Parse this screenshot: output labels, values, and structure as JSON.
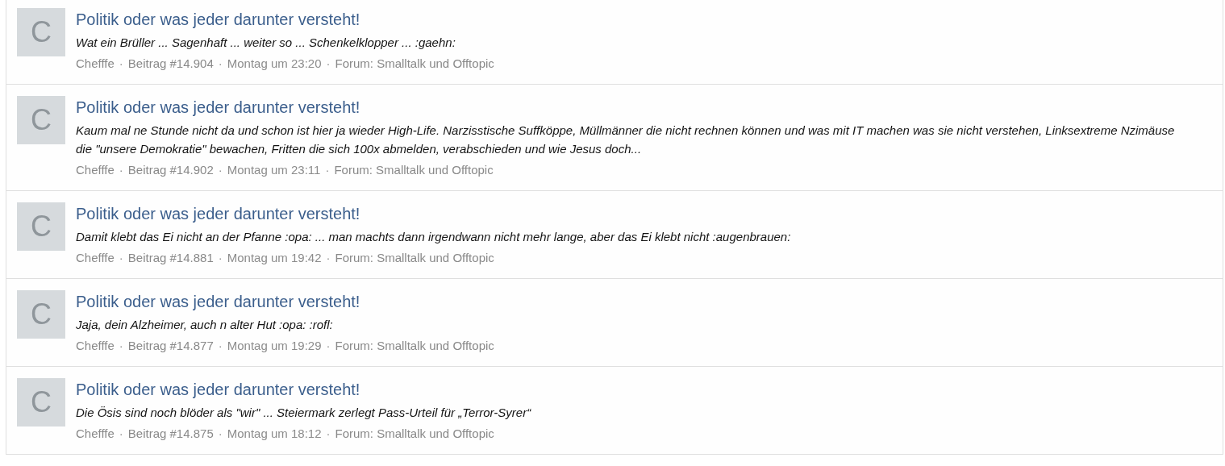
{
  "posts": [
    {
      "avatar_letter": "C",
      "title": "Politik oder was jeder darunter versteht!",
      "snippet": "Wat ein Brüller ... Sagenhaft ... weiter so ... Schenkelklopper ... :gaehn:",
      "meta": [
        {
          "kind": "author",
          "text": "Chefffe"
        },
        {
          "kind": "separator",
          "text": "·"
        },
        {
          "kind": "post_number",
          "text": "Beitrag #14.904"
        },
        {
          "kind": "separator",
          "text": "·"
        },
        {
          "kind": "time",
          "text": "Montag um 23:20"
        },
        {
          "kind": "separator",
          "text": "·"
        },
        {
          "kind": "forum",
          "text": "Forum: Smalltalk und Offtopic"
        }
      ]
    },
    {
      "avatar_letter": "C",
      "title": "Politik oder was jeder darunter versteht!",
      "snippet": "Kaum mal ne Stunde nicht da und schon ist hier ja wieder High-Life. Narzisstische Suffköppe, Müllmänner die nicht rechnen können und was mit IT machen was sie nicht verstehen, Linksextreme Nzimäuse die \"unsere Demokratie\" bewachen, Fritten die sich 100x abmelden, verabschieden und wie Jesus doch...",
      "meta": [
        {
          "kind": "author",
          "text": "Chefffe"
        },
        {
          "kind": "separator",
          "text": "·"
        },
        {
          "kind": "post_number",
          "text": "Beitrag #14.902"
        },
        {
          "kind": "separator",
          "text": "·"
        },
        {
          "kind": "time",
          "text": "Montag um 23:11"
        },
        {
          "kind": "separator",
          "text": "·"
        },
        {
          "kind": "forum",
          "text": "Forum: Smalltalk und Offtopic"
        }
      ]
    },
    {
      "avatar_letter": "C",
      "title": "Politik oder was jeder darunter versteht!",
      "snippet": "Damit klebt das Ei nicht an der Pfanne :opa: ... man machts dann irgendwann nicht mehr lange, aber das Ei klebt nicht :augenbrauen:",
      "meta": [
        {
          "kind": "author",
          "text": "Chefffe"
        },
        {
          "kind": "separator",
          "text": "·"
        },
        {
          "kind": "post_number",
          "text": "Beitrag #14.881"
        },
        {
          "kind": "separator",
          "text": "·"
        },
        {
          "kind": "time",
          "text": "Montag um 19:42"
        },
        {
          "kind": "separator",
          "text": "·"
        },
        {
          "kind": "forum",
          "text": "Forum: Smalltalk und Offtopic"
        }
      ]
    },
    {
      "avatar_letter": "C",
      "title": "Politik oder was jeder darunter versteht!",
      "snippet": "Jaja, dein Alzheimer, auch n alter Hut :opa: :rofl:",
      "meta": [
        {
          "kind": "author",
          "text": "Chefffe"
        },
        {
          "kind": "separator",
          "text": "·"
        },
        {
          "kind": "post_number",
          "text": "Beitrag #14.877"
        },
        {
          "kind": "separator",
          "text": "·"
        },
        {
          "kind": "time",
          "text": "Montag um 19:29"
        },
        {
          "kind": "separator",
          "text": "·"
        },
        {
          "kind": "forum",
          "text": "Forum: Smalltalk und Offtopic"
        }
      ]
    },
    {
      "avatar_letter": "C",
      "title": "Politik oder was jeder darunter versteht!",
      "snippet": "Die Ösis sind noch blöder als \"wir\" ... Steiermark zerlegt Pass-Urteil für „Terror-Syrer“",
      "meta": [
        {
          "kind": "author",
          "text": "Chefffe"
        },
        {
          "kind": "separator",
          "text": "·"
        },
        {
          "kind": "post_number",
          "text": "Beitrag #14.875"
        },
        {
          "kind": "separator",
          "text": "·"
        },
        {
          "kind": "time",
          "text": "Montag um 18:12"
        },
        {
          "kind": "separator",
          "text": "·"
        },
        {
          "kind": "forum",
          "text": "Forum: Smalltalk und Offtopic"
        }
      ]
    }
  ]
}
